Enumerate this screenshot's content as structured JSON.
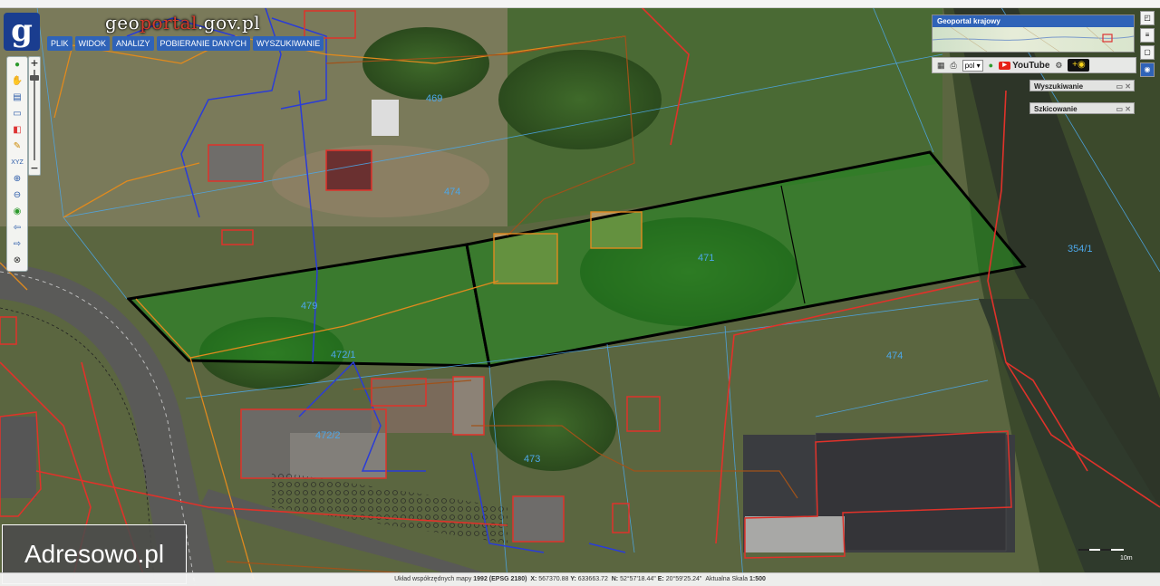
{
  "app": {
    "title_main": "geo",
    "title_accent": "portal",
    "title_tail": ".gov.pl",
    "logo_letter": "g",
    "brand_color": "#1a3d8f"
  },
  "menu": [
    "PLIK",
    "WIDOK",
    "ANALIZY",
    "POBIERANIE DANYCH",
    "WYSZUKIWANIE"
  ],
  "toolbar_icons": [
    "info-icon",
    "hand-icon",
    "layers-icon",
    "screen-icon",
    "measure-icon",
    "pencil-icon",
    "xyz-icon",
    "zoom-in-icon",
    "zoom-out-icon",
    "globe-icon",
    "back-arrow-icon",
    "forward-arrow-icon",
    "clear-icon"
  ],
  "overview": {
    "title": "Geoportal krajowy"
  },
  "right_toolbar": {
    "language": "pol",
    "youtube_label": "YouTube"
  },
  "panels": [
    {
      "title": "Wyszukiwanie"
    },
    {
      "title": "Szkicowanie"
    }
  ],
  "parcels": {
    "main_labels": [
      "479",
      "471"
    ],
    "other_labels": [
      "469",
      "474",
      "472/1",
      "472/2",
      "473",
      "474",
      "354/1"
    ]
  },
  "status_bar": {
    "prefix": "Układ współrzędnych mapy",
    "crs": "1992 (EPSG 2180)",
    "x_label": "X:",
    "x_value": "567370.88",
    "y_label": "Y:",
    "y_value": "633663.72",
    "n_label": "N:",
    "n_value": "52°57'18.44\"",
    "e_label": "E:",
    "e_value": "20°59'25.24\"",
    "scale_label": "Aktualna Skala",
    "scale_value": "1:500"
  },
  "scale_bar": {
    "label": "10m"
  },
  "watermark": "Adresowo.pl",
  "colors": {
    "parcel_highlight": "#1f8a1f",
    "boundary_red": "#e0322a",
    "network_orange": "#e08a1e",
    "network_blue": "#2a3cd8"
  }
}
